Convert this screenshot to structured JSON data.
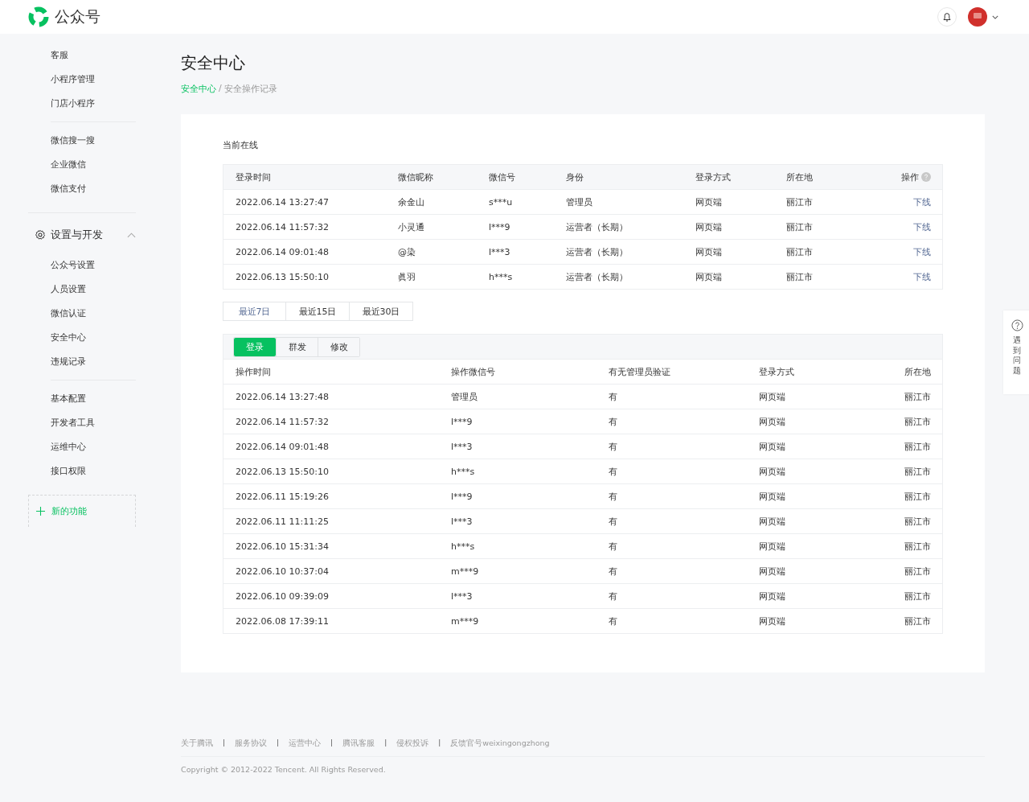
{
  "header": {
    "brand": "公众号"
  },
  "sidebar": {
    "groups": [
      {
        "items": [
          {
            "label": "客服",
            "selected": false
          },
          {
            "label": "小程序管理",
            "selected": false
          },
          {
            "label": "门店小程序",
            "selected": false
          }
        ]
      },
      {
        "items": [
          {
            "label": "微信搜一搜",
            "selected": false
          },
          {
            "label": "企业微信",
            "selected": false
          },
          {
            "label": "微信支付",
            "selected": false
          }
        ]
      },
      {
        "title": "设置与开发",
        "expanded": true,
        "items": [
          {
            "label": "公众号设置",
            "selected": false
          },
          {
            "label": "人员设置",
            "selected": false
          },
          {
            "label": "微信认证",
            "selected": false
          },
          {
            "label": "安全中心",
            "selected": false
          },
          {
            "label": "违规记录",
            "selected": false
          }
        ]
      },
      {
        "items": [
          {
            "label": "基本配置",
            "selected": false
          },
          {
            "label": "开发者工具",
            "selected": false
          },
          {
            "label": "运维中心",
            "selected": false
          },
          {
            "label": "接口权限",
            "selected": false
          }
        ]
      }
    ],
    "new_feature": "新的功能"
  },
  "page": {
    "title": "安全中心",
    "breadcrumb": [
      {
        "label": "安全中心",
        "kind": "link"
      },
      {
        "label": "/",
        "kind": "separator"
      },
      {
        "label": "安全操作记录",
        "kind": "current"
      }
    ]
  },
  "online": {
    "title": "当前在线",
    "columns": [
      "登录时间",
      "微信昵称",
      "微信号",
      "身份",
      "登录方式",
      "所在地",
      "操作"
    ],
    "rows": [
      [
        "2022.06.14 13:27:47",
        "余金山",
        "s***u",
        "管理员",
        "网页端",
        "丽江市",
        "下线"
      ],
      [
        "2022.06.14 11:57:32",
        "小灵通",
        "l***9",
        "运营者（长期）",
        "网页端",
        "丽江市",
        "下线"
      ],
      [
        "2022.06.14 09:01:48",
        "@染",
        "l***3",
        "运营者（长期）",
        "网页端",
        "丽江市",
        "下线"
      ],
      [
        "2022.06.13 15:50:10",
        "眞羽",
        "h***s",
        "运营者（长期）",
        "网页端",
        "丽江市",
        "下线"
      ]
    ]
  },
  "ranges": [
    {
      "label": "最近7日",
      "selected": true
    },
    {
      "label": "最近15日",
      "selected": false
    },
    {
      "label": "最近30日",
      "selected": false
    }
  ],
  "log": {
    "tabs": [
      {
        "label": "登录",
        "selected": true
      },
      {
        "label": "群发",
        "selected": false
      },
      {
        "label": "修改",
        "selected": false
      }
    ],
    "columns": [
      "操作时间",
      "操作微信号",
      "有无管理员验证",
      "登录方式",
      "所在地"
    ],
    "rows": [
      [
        "2022.06.14 13:27:48",
        "管理员",
        "有",
        "网页端",
        "丽江市"
      ],
      [
        "2022.06.14 11:57:32",
        "l***9",
        "有",
        "网页端",
        "丽江市"
      ],
      [
        "2022.06.14 09:01:48",
        "l***3",
        "有",
        "网页端",
        "丽江市"
      ],
      [
        "2022.06.13 15:50:10",
        "h***s",
        "有",
        "网页端",
        "丽江市"
      ],
      [
        "2022.06.11 15:19:26",
        "l***9",
        "有",
        "网页端",
        "丽江市"
      ],
      [
        "2022.06.11 11:11:25",
        "l***3",
        "有",
        "网页端",
        "丽江市"
      ],
      [
        "2022.06.10 15:31:34",
        "h***s",
        "有",
        "网页端",
        "丽江市"
      ],
      [
        "2022.06.10 10:37:04",
        "m***9",
        "有",
        "网页端",
        "丽江市"
      ],
      [
        "2022.06.10 09:39:09",
        "l***3",
        "有",
        "网页端",
        "丽江市"
      ],
      [
        "2022.06.08 17:39:11",
        "m***9",
        "有",
        "网页端",
        "丽江市"
      ]
    ]
  },
  "footer": {
    "links": [
      {
        "kind": "link",
        "text": "关于腾讯"
      },
      {
        "kind": "separator",
        "text": "|"
      },
      {
        "kind": "link",
        "text": "服务协议"
      },
      {
        "kind": "separator",
        "text": "|"
      },
      {
        "kind": "link",
        "text": "运营中心"
      },
      {
        "kind": "separator",
        "text": "|"
      },
      {
        "kind": "link",
        "text": "腾讯客服"
      },
      {
        "kind": "separator",
        "text": "|"
      },
      {
        "kind": "link",
        "text": "侵权投诉"
      },
      {
        "kind": "separator",
        "text": "|"
      },
      {
        "kind": "link",
        "text": "反馈官号weixingongzhong"
      }
    ],
    "copyright": "Copyright © 2012-2022 Tencent. All Rights Reserved."
  },
  "help": {
    "label": "遇到问题"
  }
}
